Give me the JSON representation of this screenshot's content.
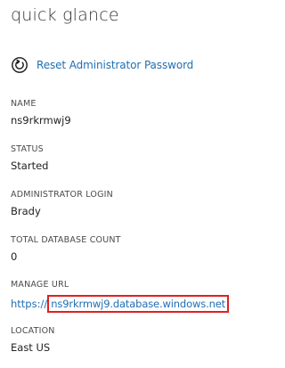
{
  "panel": {
    "title": "quick glance",
    "reset_action": {
      "label": "Reset Administrator Password",
      "icon": "refresh-icon",
      "color": "#1f6fb3"
    },
    "fields": {
      "name": {
        "label": "NAME",
        "value": "ns9rkrmwj9"
      },
      "status": {
        "label": "STATUS",
        "value": "Started"
      },
      "admin_login": {
        "label": "ADMINISTRATOR LOGIN",
        "value": "Brady"
      },
      "db_count": {
        "label": "TOTAL DATABASE COUNT",
        "value": "0"
      },
      "manage_url": {
        "label": "MANAGE URL",
        "prefix": "https://",
        "host": "ns9rkrmwj9.database.windows.net",
        "highlight_color": "#e02020"
      },
      "location": {
        "label": "LOCATION",
        "value": "East US"
      }
    }
  }
}
